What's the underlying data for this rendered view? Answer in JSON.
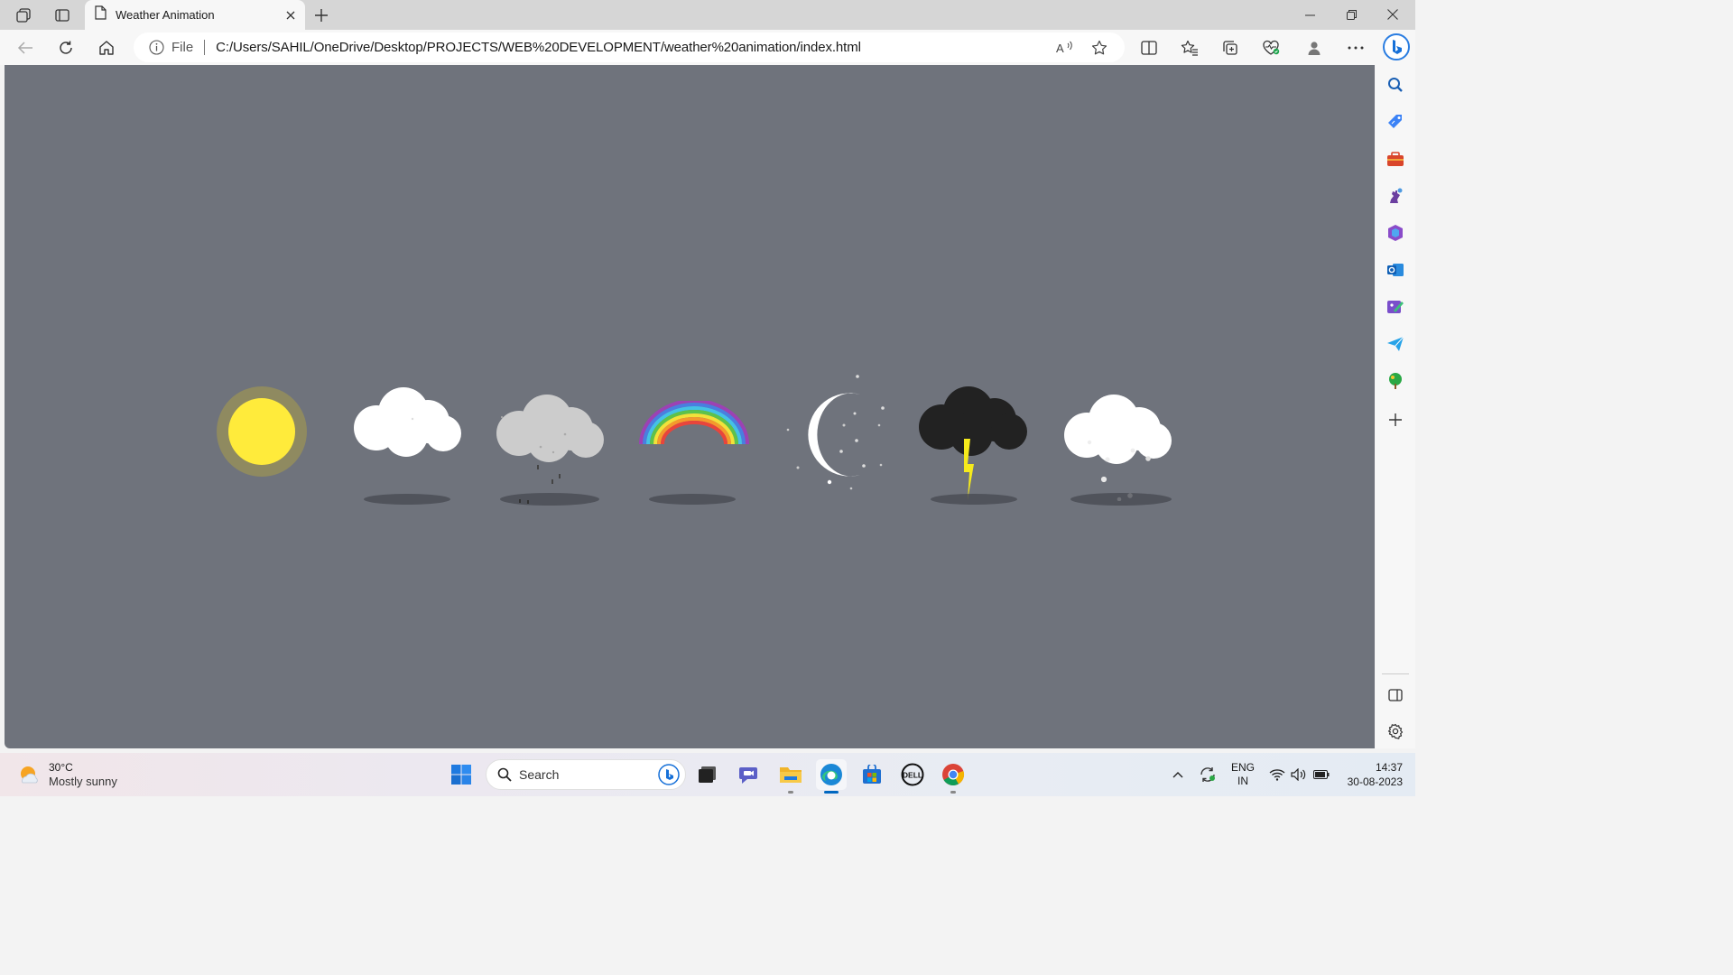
{
  "browser": {
    "tab": {
      "title": "Weather Animation"
    },
    "address": {
      "scheme_label": "File",
      "url": "C:/Users/SAHIL/OneDrive/Desktop/PROJECTS/WEB%20DEVELOPMENT/weather%20animation/index.html"
    },
    "accent": "#0067c0"
  },
  "page": {
    "background": "#6f737c",
    "weather_icons": [
      "sun",
      "cloud",
      "rain-cloud",
      "rainbow",
      "moon-night",
      "thunderstorm",
      "snow-cloud"
    ]
  },
  "sidebar": {
    "items": [
      "search-icon",
      "shopping-icon",
      "tools-icon",
      "games-icon",
      "office-icon",
      "outlook-icon",
      "designer-icon",
      "send-icon",
      "tree-icon",
      "add-icon"
    ]
  },
  "taskbar": {
    "weather": {
      "temp": "30°C",
      "condition": "Mostly sunny"
    },
    "search_label": "Search",
    "lang": {
      "line1": "ENG",
      "line2": "IN"
    },
    "clock": {
      "time": "14:37",
      "date": "30-08-2023"
    }
  }
}
